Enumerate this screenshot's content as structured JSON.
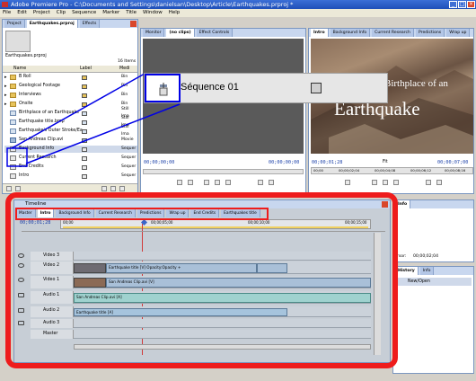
{
  "window": {
    "title": "Adobe Premiere Pro - C:\\Documents and Settings\\danielsan\\Desktop\\Article\\Earthquakes.prproj *"
  },
  "menu": [
    "File",
    "Edit",
    "Project",
    "Clip",
    "Sequence",
    "Marker",
    "Title",
    "Window",
    "Help"
  ],
  "project_panel": {
    "tabs": [
      "Project",
      "Earthquakes.prproj",
      "Effects"
    ],
    "items_count": "16 Items",
    "columns": [
      "Name",
      "Label",
      "Medi"
    ],
    "items": [
      {
        "name": "B Roll",
        "type": "Bin",
        "icon": "bin",
        "color": "#e7c35a"
      },
      {
        "name": "Geological Footage",
        "type": "Bin",
        "icon": "bin",
        "color": "#e7c35a"
      },
      {
        "name": "Interviews",
        "type": "Bin",
        "icon": "bin",
        "color": "#e7c35a"
      },
      {
        "name": "Onsite",
        "type": "Bin",
        "icon": "bin",
        "color": "#e7c35a"
      },
      {
        "name": "Birthplace of an Earthquake",
        "type": "Still Ima",
        "icon": "still",
        "color": "#d6e2ef"
      },
      {
        "name": "Earthquake title.bmp",
        "type": "Still Ima",
        "icon": "still",
        "color": "#d6e2ef"
      },
      {
        "name": "Earthquake's Outer Stroke/Ea",
        "type": "Still Ima",
        "icon": "still",
        "color": "#d6e2ef"
      },
      {
        "name": "San Andreas Clip.avi",
        "type": "Movie",
        "icon": "movie",
        "color": "#9fb7d6"
      },
      {
        "name": "Background Info",
        "type": "Sequer",
        "icon": "sequence",
        "color": "#e8e8e8"
      },
      {
        "name": "Current Research",
        "type": "Sequer",
        "icon": "sequence",
        "color": "#e8e8e8"
      },
      {
        "name": "End Credits",
        "type": "Sequer",
        "icon": "sequence",
        "color": "#e8e8e8"
      },
      {
        "name": "Intro",
        "type": "Sequer",
        "icon": "sequence",
        "color": "#e8e8e8"
      }
    ]
  },
  "callout": {
    "label": "Séquence 01"
  },
  "source_monitor": {
    "tabs": [
      "Monitor",
      "(no clips)",
      "Effect Controls"
    ],
    "timecode_left": "00;00;00;00",
    "timecode_right": "00;00;00;00"
  },
  "program_monitor": {
    "tabs": [
      "Intro",
      "Background Info",
      "Current Research",
      "Predictions",
      "Wrap up"
    ],
    "title_line1": "Birthplace of an",
    "title_line2": "Earthquake",
    "timecode_current": "00;00;01;28",
    "fit": "Fit",
    "timecode_end": "00;00;07;00",
    "ruler": [
      "00;00",
      "00;00;02;04",
      "00;00;04;08",
      "00;00;06;12",
      "00;00;08;16"
    ]
  },
  "timeline": {
    "title": "Timeline",
    "tabs": [
      "Master",
      "Intro",
      "Background Info",
      "Current Research",
      "Predictions",
      "Wrap up",
      "End Credits",
      "Earthquakes title"
    ],
    "timecode": "00;00;01;28",
    "ruler": [
      "00;00",
      "00;00;05;00",
      "00;00;10;00",
      "00;00;15;00"
    ],
    "tracks": [
      {
        "label": "Video 3",
        "kind": "video"
      },
      {
        "label": "Video 2",
        "kind": "video"
      },
      {
        "label": "Video 1",
        "kind": "video"
      },
      {
        "label": "Audio 1",
        "kind": "audio"
      },
      {
        "label": "Audio 2",
        "kind": "audio"
      },
      {
        "label": "Audio 3",
        "kind": "audio"
      },
      {
        "label": "Master",
        "kind": "master"
      }
    ],
    "clips": {
      "v2": "Earthquake title [V] Opacity:Opacity +",
      "v1": "San Andreas Clip.avi [V]",
      "a1": "San Andreas Clip.avi [A]",
      "a2": "Earthquake title [A]"
    }
  },
  "right_panels": {
    "tabs": [
      "Info"
    ],
    "cursor_label": "rsor:",
    "cursor_value": "00;00;02;04",
    "history_tabs": [
      "History",
      "Info"
    ],
    "history_item": "New/Open"
  },
  "colors": {
    "highlight_red": "#ee1c1c",
    "callout_blue": "#0000e6"
  }
}
